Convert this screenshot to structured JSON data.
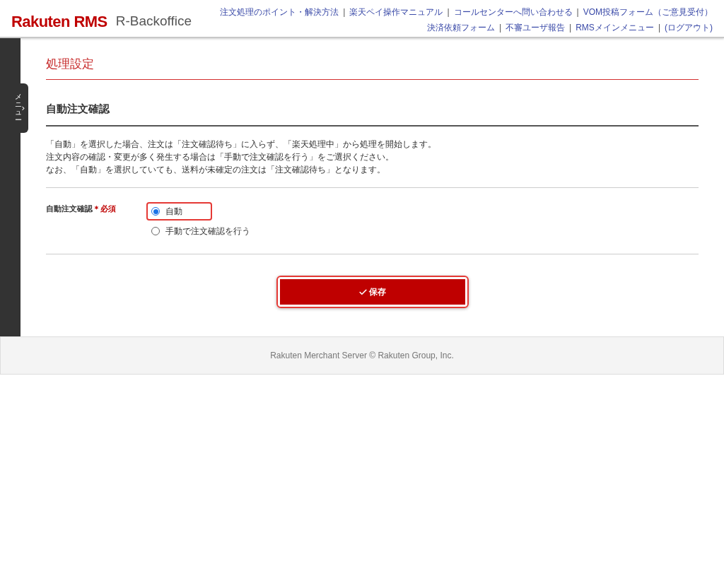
{
  "header": {
    "logo": "Rakuten RMS",
    "product": "R-Backoffice",
    "links_row_1": [
      "注文処理のポイント・解決方法",
      "楽天ペイ操作マニュアル",
      "コールセンターへ問い合わせる",
      "VOM投稿フォーム（ご意見受付）"
    ],
    "links_row_2": [
      "決済依頼フォーム",
      "不審ユーザ報告",
      "RMSメインメニュー",
      "(ログアウト)"
    ],
    "separator": "|"
  },
  "side_menu": {
    "label": "メニュー",
    "toggle": "›"
  },
  "page_title": "処理設定",
  "section_title": "自動注文確認",
  "description": [
    "「自動」を選択した場合、注文は「注文確認待ち」に入らず、「楽天処理中」から処理を開始します。",
    "注文内容の確認・変更が多く発生する場合は「手動で注文確認を行う」をご選択ください。",
    "なお、「自動」を選択していても、送料が未確定の注文は「注文確認待ち」となります。"
  ],
  "field": {
    "label": "自動注文確認",
    "required": "＊必須",
    "options": [
      {
        "label": "自動",
        "selected": true,
        "highlighted": true
      },
      {
        "label": "手動で注文確認を行う",
        "selected": false,
        "highlighted": false
      }
    ]
  },
  "save_button": {
    "label": "保存",
    "highlighted": true
  },
  "footer": "Rakuten Merchant Server © Rakuten Group, Inc."
}
